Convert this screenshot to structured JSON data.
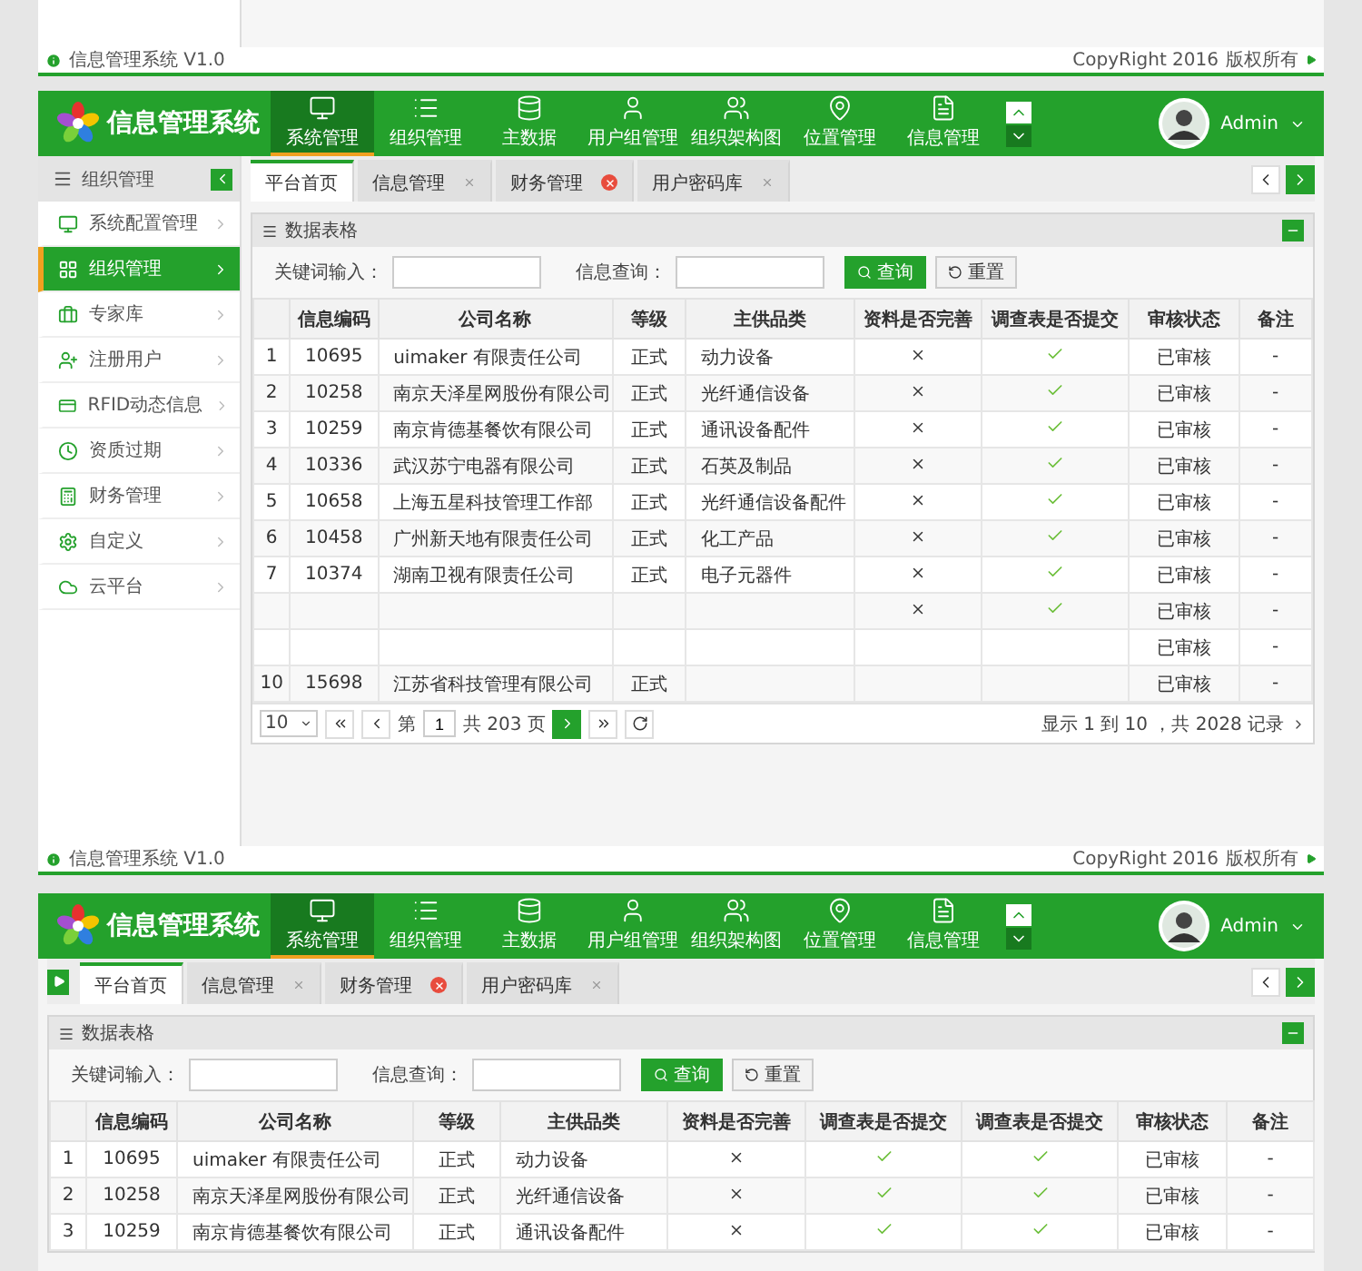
{
  "previous_footer": {
    "title": "信息管理系统 V1.0",
    "copyright": "CopyRight 2016",
    "rights": "版权所有"
  },
  "screens": [
    {
      "header": {
        "title": "信息管理系统",
        "nav": [
          {
            "label": "系统管理",
            "selected": true
          },
          {
            "label": "组织管理",
            "selected": false
          },
          {
            "label": "主数据",
            "selected": false
          },
          {
            "label": "用户组管理",
            "selected": false
          },
          {
            "label": "组织架构图",
            "selected": false
          },
          {
            "label": "位置管理",
            "selected": false
          },
          {
            "label": "信息管理",
            "selected": false
          }
        ],
        "user": "Admin"
      },
      "sidebar": {
        "title": "组织管理",
        "items": [
          {
            "label": "系统配置管理",
            "selected": false
          },
          {
            "label": "组织管理",
            "selected": true
          },
          {
            "label": "专家库",
            "selected": false
          },
          {
            "label": "注册用户",
            "selected": false
          },
          {
            "label": "RFID动态信息",
            "selected": false
          },
          {
            "label": "资质过期",
            "selected": false
          },
          {
            "label": "财务管理",
            "selected": false
          },
          {
            "label": "自定义",
            "selected": false
          },
          {
            "label": "云平台",
            "selected": false
          }
        ]
      },
      "tabs": [
        {
          "label": "平台首页",
          "selected": true,
          "closable": false
        },
        {
          "label": "信息管理",
          "selected": false,
          "closable": true,
          "alert": false
        },
        {
          "label": "财务管理",
          "selected": false,
          "closable": true,
          "alert": true
        },
        {
          "label": "用户密码库",
          "selected": false,
          "closable": true,
          "alert": false
        }
      ],
      "panel": {
        "title": "数据表格",
        "search": [
          {
            "label": "关键词输入："
          },
          {
            "label": "信息查询："
          }
        ],
        "buttons": [
          {
            "label": "查询",
            "kind": "primary"
          },
          {
            "label": "重置",
            "kind": "reset"
          }
        ],
        "table": {
          "columns": [
            "信息编码",
            "公司名称",
            "等级",
            "主供品类",
            "资料是否完善",
            "调查表是否提交",
            "审核状态",
            "备注"
          ],
          "rows": [
            {
              "no": "1",
              "code": "10695",
              "company": "uimaker 有限责任公司",
              "grade": "正式",
              "category": "动力设备",
              "checks": [
                false,
                true
              ],
              "status": "已审核",
              "note": "-"
            },
            {
              "no": "2",
              "code": "10258",
              "company": "南京天泽星网股份有限公司",
              "grade": "正式",
              "category": "光纤通信设备",
              "checks": [
                false,
                true
              ],
              "status": "已审核",
              "note": "-"
            },
            {
              "no": "3",
              "code": "10259",
              "company": "南京肯德基餐饮有限公司",
              "grade": "正式",
              "category": "通讯设备配件",
              "checks": [
                false,
                true
              ],
              "status": "已审核",
              "note": "-"
            },
            {
              "no": "4",
              "code": "10336",
              "company": "武汉苏宁电器有限公司",
              "grade": "正式",
              "category": "石英及制品",
              "checks": [
                false,
                true
              ],
              "status": "已审核",
              "note": "-"
            },
            {
              "no": "5",
              "code": "10658",
              "company": "上海五星科技管理工作部",
              "grade": "正式",
              "category": "光纤通信设备配件",
              "checks": [
                false,
                true
              ],
              "status": "已审核",
              "note": "-"
            },
            {
              "no": "6",
              "code": "10458",
              "company": "广州新天地有限责任公司",
              "grade": "正式",
              "category": "化工产品",
              "checks": [
                false,
                true
              ],
              "status": "已审核",
              "note": "-"
            },
            {
              "no": "7",
              "code": "10374",
              "company": "湖南卫视有限责任公司",
              "grade": "正式",
              "category": "电子元器件",
              "checks": [
                false,
                true
              ],
              "status": "已审核",
              "note": "-"
            },
            {
              "checks": [
                false,
                true
              ],
              "status": "已审核",
              "note": "-"
            },
            {
              "status": "已审核",
              "note": "-"
            },
            {
              "no": "10",
              "code": "15698",
              "company": "江苏省科技管理有限公司",
              "grade": "正式",
              "status": "已审核",
              "note": "-"
            }
          ]
        },
        "pagination": {
          "page_size": "10",
          "page_label": "第",
          "page": "1",
          "pages": "共 203 页",
          "summary": "显示 1 到 10 ，共 2028 记录"
        }
      },
      "footer": {
        "title": "信息管理系统 V1.0",
        "copyright": "CopyRight 2016",
        "rights": "版权所有"
      }
    },
    {
      "header": {
        "title": "信息管理系统",
        "nav": [
          {
            "label": "系统管理",
            "selected": true
          },
          {
            "label": "组织管理",
            "selected": false
          },
          {
            "label": "主数据",
            "selected": false
          },
          {
            "label": "用户组管理",
            "selected": false
          },
          {
            "label": "组织架构图",
            "selected": false
          },
          {
            "label": "位置管理",
            "selected": false
          },
          {
            "label": "信息管理",
            "selected": false
          }
        ],
        "user": "Admin"
      },
      "tabs": [
        {
          "label": "平台首页",
          "selected": true,
          "closable": false
        },
        {
          "label": "信息管理",
          "selected": false,
          "closable": true,
          "alert": false
        },
        {
          "label": "财务管理",
          "selected": false,
          "closable": true,
          "alert": true
        },
        {
          "label": "用户密码库",
          "selected": false,
          "closable": true,
          "alert": false
        }
      ],
      "panel": {
        "title": "数据表格",
        "search": [
          {
            "label": "关键词输入："
          },
          {
            "label": "信息查询："
          }
        ],
        "buttons": [
          {
            "label": "查询",
            "kind": "primary"
          },
          {
            "label": "重置",
            "kind": "reset"
          }
        ],
        "table": {
          "columns": [
            "信息编码",
            "公司名称",
            "等级",
            "主供品类",
            "资料是否完善",
            "调查表是否提交",
            "调查表是否提交",
            "审核状态",
            "备注"
          ],
          "rows": [
            {
              "no": "1",
              "code": "10695",
              "company": "uimaker 有限责任公司",
              "grade": "正式",
              "category": "动力设备",
              "checks": [
                false,
                true,
                true
              ],
              "status": "已审核",
              "note": "-"
            },
            {
              "no": "2",
              "code": "10258",
              "company": "南京天泽星网股份有限公司",
              "grade": "正式",
              "category": "光纤通信设备",
              "checks": [
                false,
                true,
                true
              ],
              "status": "已审核",
              "note": "-"
            },
            {
              "no": "3",
              "code": "10259",
              "company": "南京肯德基餐饮有限公司",
              "grade": "正式",
              "category": "通讯设备配件",
              "checks": [
                false,
                true,
                true
              ],
              "status": "已审核",
              "note": "-"
            }
          ]
        }
      }
    }
  ]
}
